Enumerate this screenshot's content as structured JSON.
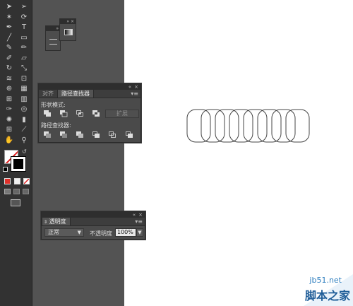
{
  "app": {
    "accent": "#ffffff",
    "panel_bg": "#4a4a4a",
    "ui_bg": "#535353"
  },
  "toolbar": {
    "tools": [
      {
        "name": "selection-tool-icon",
        "glyph": "➤"
      },
      {
        "name": "direct-selection-tool-icon",
        "glyph": "➢"
      },
      {
        "name": "magic-wand-tool-icon",
        "glyph": "✶"
      },
      {
        "name": "lasso-tool-icon",
        "glyph": "⟳"
      },
      {
        "name": "pen-tool-icon",
        "glyph": "✒"
      },
      {
        "name": "type-tool-icon",
        "glyph": "T"
      },
      {
        "name": "line-tool-icon",
        "glyph": "╱"
      },
      {
        "name": "rectangle-tool-icon",
        "glyph": "▭"
      },
      {
        "name": "paintbrush-tool-icon",
        "glyph": "✎"
      },
      {
        "name": "pencil-tool-icon",
        "glyph": "✏"
      },
      {
        "name": "blob-brush-tool-icon",
        "glyph": "✐"
      },
      {
        "name": "eraser-tool-icon",
        "glyph": "▱"
      },
      {
        "name": "rotate-tool-icon",
        "glyph": "↻"
      },
      {
        "name": "scale-tool-icon",
        "glyph": "⤡"
      },
      {
        "name": "width-tool-icon",
        "glyph": "≋"
      },
      {
        "name": "free-transform-tool-icon",
        "glyph": "⊡"
      },
      {
        "name": "shape-builder-tool-icon",
        "glyph": "⊕"
      },
      {
        "name": "perspective-grid-tool-icon",
        "glyph": "▦"
      },
      {
        "name": "mesh-tool-icon",
        "glyph": "⊞"
      },
      {
        "name": "gradient-tool-icon",
        "glyph": "▥"
      },
      {
        "name": "eyedropper-tool-icon",
        "glyph": "✑"
      },
      {
        "name": "blend-tool-icon",
        "glyph": "◎"
      },
      {
        "name": "symbol-sprayer-tool-icon",
        "glyph": "✺"
      },
      {
        "name": "column-graph-tool-icon",
        "glyph": "▮"
      },
      {
        "name": "artboard-tool-icon",
        "glyph": "⊞"
      },
      {
        "name": "slice-tool-icon",
        "glyph": "⟋"
      },
      {
        "name": "hand-tool-icon",
        "glyph": "✋"
      },
      {
        "name": "zoom-tool-icon",
        "glyph": "⚲"
      }
    ]
  },
  "pathfinder_panel": {
    "tabs": [
      {
        "label": "对齐"
      },
      {
        "label": "路径查找器"
      }
    ],
    "shape_modes_label": "形状模式:",
    "pathfinders_label": "路径查找器:",
    "expand_label": "扩展",
    "shape_mode_buttons": [
      "unite",
      "minus-front",
      "intersect",
      "exclude"
    ],
    "pathfinder_buttons": [
      "divide",
      "trim",
      "merge",
      "crop",
      "outline",
      "minus-back"
    ]
  },
  "transparency_panel": {
    "tab_label": "透明度",
    "blend_mode": "正常",
    "opacity_label": "不透明度",
    "opacity_value": "100%"
  },
  "artboard": {
    "capsule_count": 8,
    "stroke": "#444444"
  },
  "watermark": {
    "url": "jb51.net",
    "brand": "脚本之家"
  }
}
